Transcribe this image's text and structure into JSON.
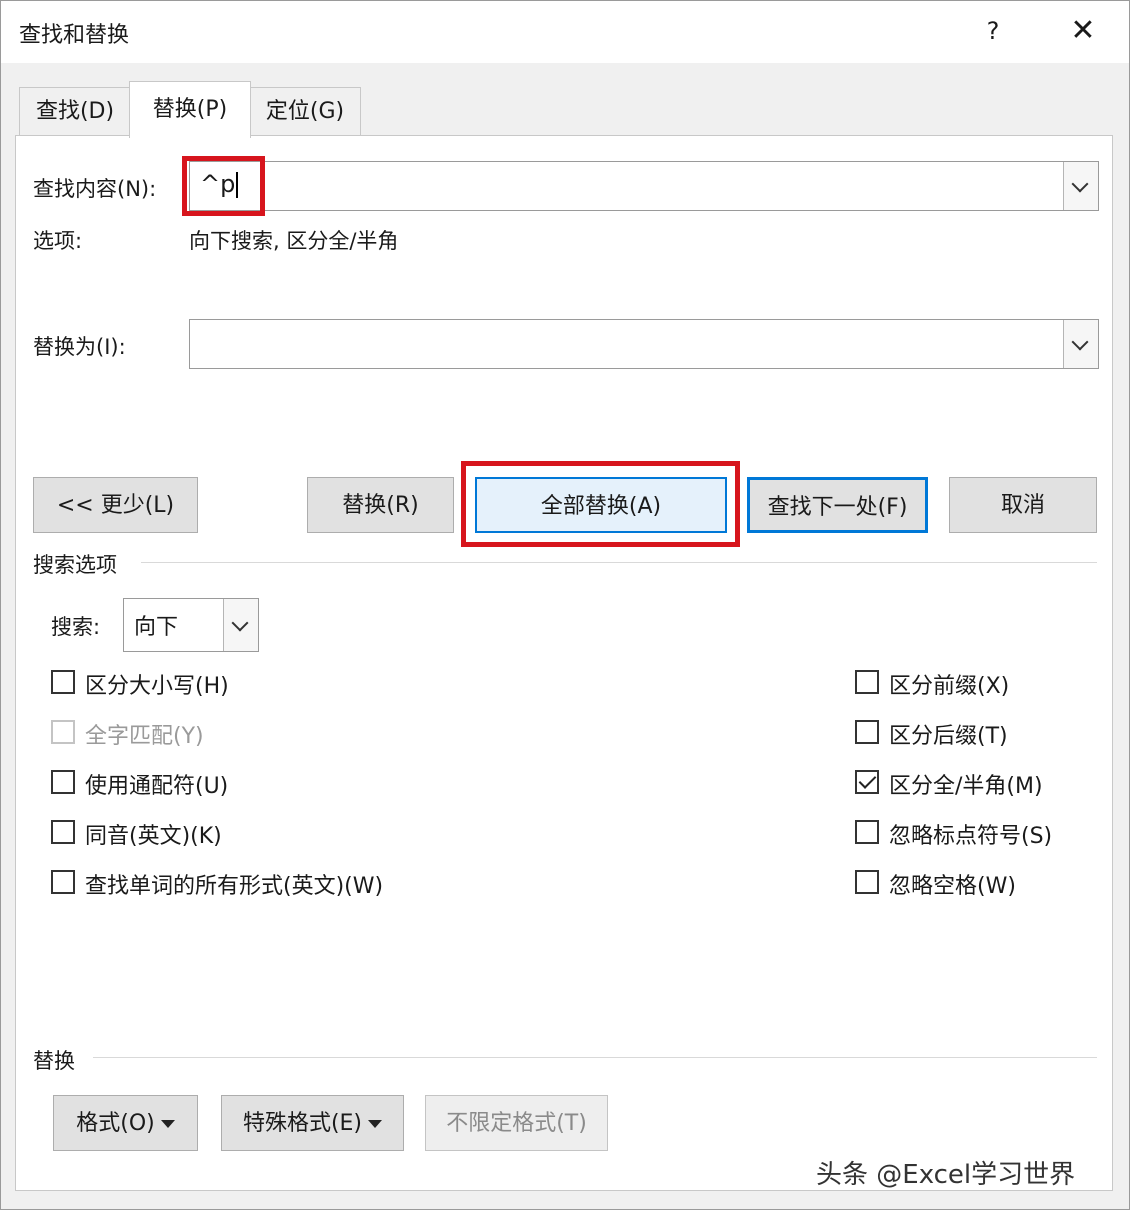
{
  "dialog": {
    "title": "查找和替换",
    "help_label": "?",
    "close_label": "✕"
  },
  "tabs": [
    {
      "label": "查找(D)",
      "active": false
    },
    {
      "label": "替换(P)",
      "active": true
    },
    {
      "label": "定位(G)",
      "active": false
    }
  ],
  "find": {
    "label": "查找内容(N):",
    "value": "^p"
  },
  "options": {
    "label": "选项:",
    "value": "向下搜索, 区分全/半角"
  },
  "replace": {
    "label": "替换为(I):",
    "value": ""
  },
  "buttons": {
    "less": "<< 更少(L)",
    "replace": "替换(R)",
    "replace_all": "全部替换(A)",
    "find_next": "查找下一处(F)",
    "cancel": "取消"
  },
  "search_options": {
    "heading": "搜索选项",
    "direction_label": "搜索:",
    "direction_value": "向下",
    "left": [
      {
        "label": "区分大小写(H)",
        "checked": false,
        "disabled": false
      },
      {
        "label": "全字匹配(Y)",
        "checked": false,
        "disabled": true
      },
      {
        "label": "使用通配符(U)",
        "checked": false,
        "disabled": false
      },
      {
        "label": "同音(英文)(K)",
        "checked": false,
        "disabled": false
      },
      {
        "label": "查找单词的所有形式(英文)(W)",
        "checked": false,
        "disabled": false
      }
    ],
    "right": [
      {
        "label": "区分前缀(X)",
        "checked": false,
        "disabled": false
      },
      {
        "label": "区分后缀(T)",
        "checked": false,
        "disabled": false
      },
      {
        "label": "区分全/半角(M)",
        "checked": true,
        "disabled": false
      },
      {
        "label": "忽略标点符号(S)",
        "checked": false,
        "disabled": false
      },
      {
        "label": "忽略空格(W)",
        "checked": false,
        "disabled": false
      }
    ]
  },
  "replace_section": {
    "heading": "替换",
    "format_label": "格式(O)",
    "special_label": "特殊格式(E)",
    "no_format_label": "不限定格式(T)"
  },
  "watermark": "头条 @Excel学习世界",
  "colors": {
    "highlight": "#d7151d",
    "focus_blue": "#0078d7"
  }
}
